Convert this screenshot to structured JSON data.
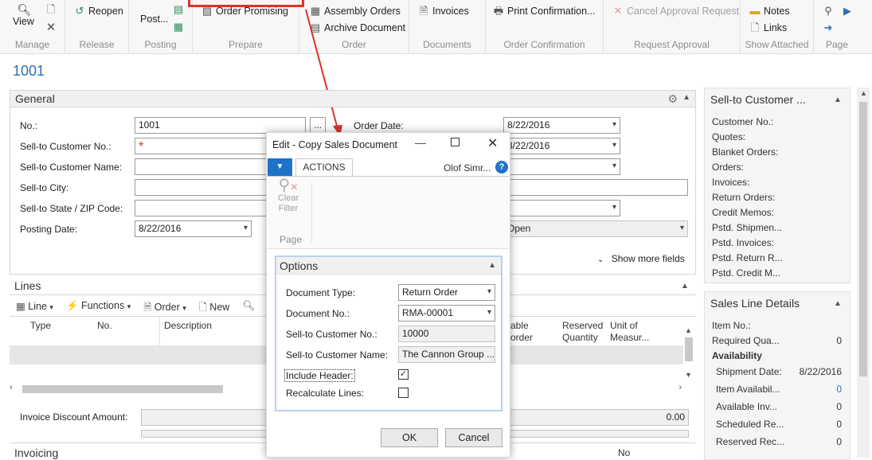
{
  "ribbon": {
    "groups": {
      "manage": "Manage",
      "release": "Release",
      "posting": "Posting",
      "prepare": "Prepare",
      "order": "Order",
      "documents": "Documents",
      "order_confirmation": "Order Confirmation",
      "request_approval": "Request Approval",
      "show_attached": "Show Attached",
      "page": "Page"
    },
    "buttons": {
      "view": "View",
      "reopen": "Reopen",
      "post": "Post...",
      "order_promising": "Order Promising",
      "assembly_orders": "Assembly Orders",
      "archive_document": "Archive Document",
      "invoices": "Invoices",
      "print_confirmation": "Print Confirmation...",
      "cancel_approval": "Cancel Approval Request",
      "notes": "Notes",
      "links": "Links"
    }
  },
  "page_title": "1001",
  "general": {
    "title": "General",
    "fields": {
      "no_label": "No.:",
      "no_value": "1001",
      "sell_to_customer_no_label": "Sell-to Customer No.:",
      "required_marker": "*",
      "sell_to_customer_name_label": "Sell-to Customer Name:",
      "sell_to_city_label": "Sell-to City:",
      "sell_to_state_zip_label": "Sell-to State / ZIP Code:",
      "posting_date_label": "Posting Date:",
      "posting_date_value": "8/22/2016",
      "order_date_label": "Order Date:",
      "order_date_value": "8/22/2016",
      "second_date_value": "8/22/2016",
      "status_value": "Open",
      "assist_button": "..."
    },
    "show_more": "Show more fields"
  },
  "lines": {
    "title": "Lines",
    "toolbar": {
      "line": "Line",
      "functions": "Functions",
      "order": "Order",
      "new": "New"
    },
    "columns": {
      "type": "Type",
      "no": "No.",
      "description": "Description",
      "able_order": "able\norder",
      "reserved_qty_1": "Reserved",
      "reserved_qty_2": "Quantity",
      "unit_of_measure_1": "Unit of",
      "unit_of_measure_2": "Measur..."
    }
  },
  "totals": {
    "invoice_discount_label": "Invoice Discount Amount:",
    "invoice_discount_value": "0.00",
    "second_value": "0.00"
  },
  "invoicing": {
    "title": "Invoicing",
    "col_no": "No"
  },
  "factbox_customer": {
    "title": "Sell-to Customer ...",
    "items": [
      "Customer No.:",
      "Quotes:",
      "Blanket Orders:",
      "Orders:",
      "Invoices:",
      "Return Orders:",
      "Credit Memos:",
      "Pstd. Shipmen...",
      "Pstd. Invoices:",
      "Pstd. Return R...",
      "Pstd. Credit M..."
    ]
  },
  "factbox_line": {
    "title": "Sales Line Details",
    "item_no": "Item No.:",
    "required_qty": "Required Qua...",
    "required_qty_value": "0",
    "availability": "Availability",
    "rows": [
      {
        "label": "Shipment Date:",
        "value": "8/22/2016"
      },
      {
        "label": "Item Availabil...",
        "value": "0"
      },
      {
        "label": "Available Inv...",
        "value": "0"
      },
      {
        "label": "Scheduled Re...",
        "value": "0"
      },
      {
        "label": "Reserved Rec...",
        "value": "0"
      }
    ]
  },
  "dialog": {
    "title": "Edit - Copy Sales Document",
    "tab_actions": "ACTIONS",
    "user": "Olof Simr...",
    "help": "?",
    "clear_filter_1": "Clear",
    "clear_filter_2": "Filter",
    "page_group": "Page",
    "options_title": "Options",
    "document_type_label": "Document Type:",
    "document_type_value": "Return Order",
    "document_no_label": "Document No.:",
    "document_no_value": "RMA-00001",
    "customer_no_label": "Sell-to Customer No.:",
    "customer_no_value": "10000",
    "customer_name_label": "Sell-to Customer Name:",
    "customer_name_value": "The Cannon Group ...",
    "include_header_label": "Include Header:",
    "include_header_checked": true,
    "recalculate_lines_label": "Recalculate Lines:",
    "recalculate_lines_checked": false,
    "ok": "OK",
    "cancel": "Cancel"
  },
  "colors": {
    "accent": "#2b6fb6",
    "annotation_red": "#d9342b",
    "dialog_blue": "#1e73c9"
  }
}
